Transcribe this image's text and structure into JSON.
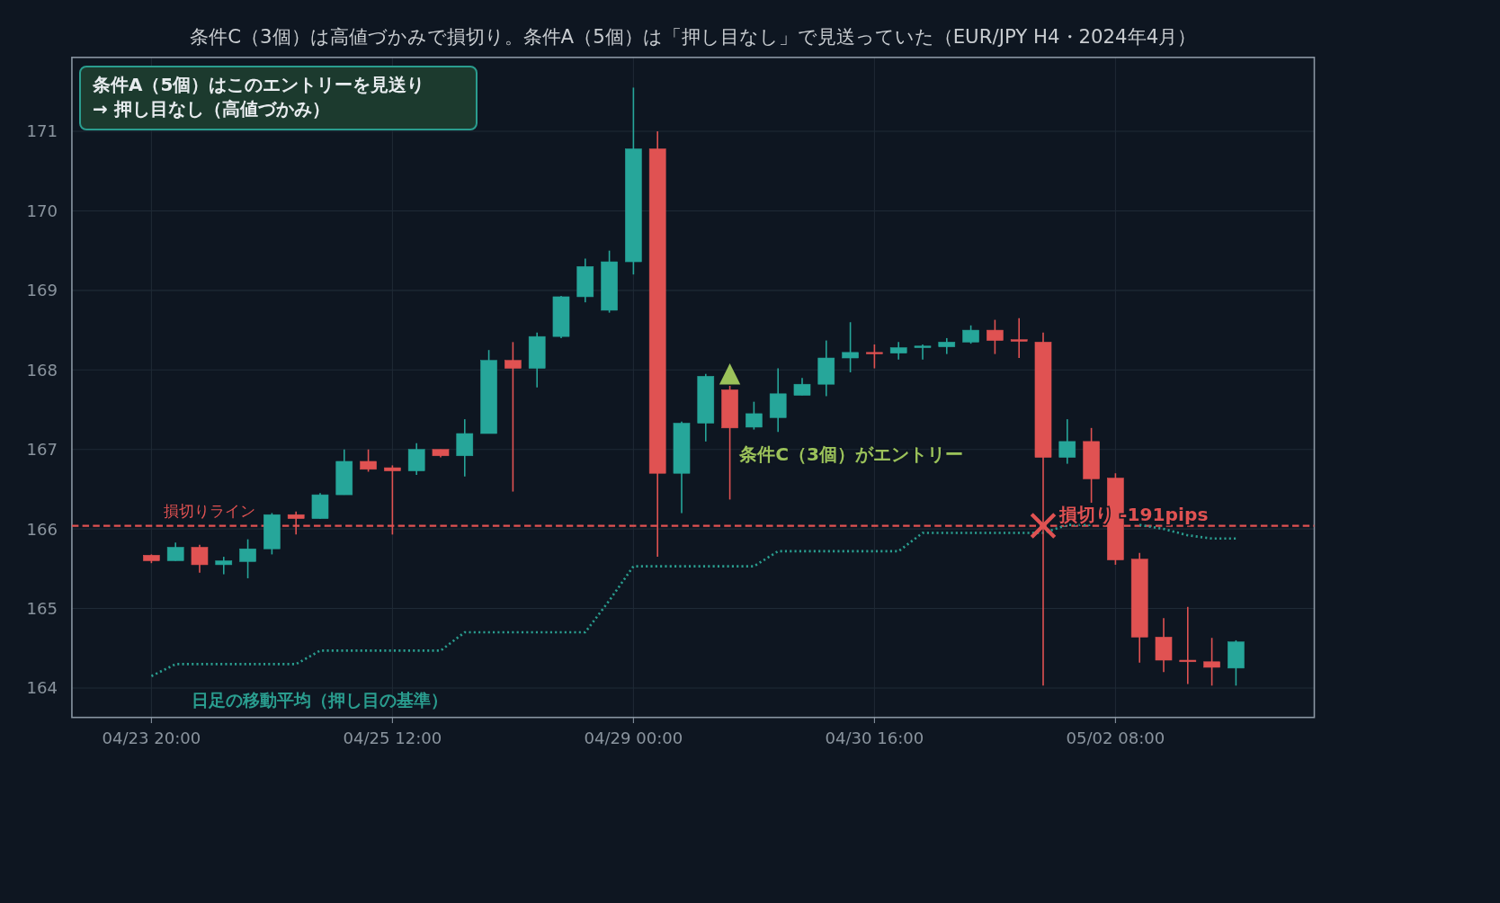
{
  "callout": {
    "lines": [
      "条件A（5個）はこのエントリーを見送り",
      "→ 押し目なし（高値づかみ）"
    ]
  },
  "chart_data": {
    "type": "line",
    "title": "条件C（3個）は高値づかみで損切り。条件A（5個）は「押し目なし」で見送っていた（EUR/JPY H4・2024年4月）",
    "categories": [
      "04/23 20:00",
      null,
      null,
      null,
      null,
      null,
      null,
      null,
      null,
      null,
      "04/25 12:00",
      null,
      null,
      null,
      null,
      null,
      null,
      null,
      null,
      null,
      "04/29 00:00",
      null,
      null,
      null,
      null,
      null,
      null,
      null,
      null,
      null,
      "04/30 16:00",
      null,
      null,
      null,
      null,
      null,
      null,
      null,
      null,
      null,
      "05/02 08:00",
      null,
      null,
      null,
      null,
      null
    ],
    "series": [
      {
        "name": "日足の移動平均（押し目の基準）",
        "color": "#2a9d8f",
        "line_style": "dotted",
        "values": [
          164.15,
          164.3,
          164.3,
          164.3,
          164.3,
          164.3,
          164.3,
          164.47,
          164.47,
          164.47,
          164.47,
          164.47,
          164.47,
          164.7,
          164.7,
          164.7,
          164.7,
          164.7,
          164.7,
          165.1,
          165.53,
          165.53,
          165.53,
          165.53,
          165.53,
          165.53,
          165.72,
          165.72,
          165.72,
          165.72,
          165.72,
          165.72,
          165.95,
          165.95,
          165.95,
          165.95,
          165.95,
          165.95,
          166.05,
          166.05,
          null,
          166.05,
          166.0,
          165.92,
          165.88,
          165.88
        ]
      }
    ],
    "ylim": [
      163.63,
      171.93
    ],
    "yticks": [
      164,
      165,
      166,
      167,
      168,
      169,
      170,
      171
    ],
    "grid": true,
    "ref_lines": [
      {
        "axis": "y",
        "value": 166.04,
        "color": "#e05252",
        "line_style": "dashed",
        "label": "損切りライン"
      }
    ],
    "annotations": [
      "条件C（3個）がエントリー",
      "損切り -191pips"
    ]
  }
}
